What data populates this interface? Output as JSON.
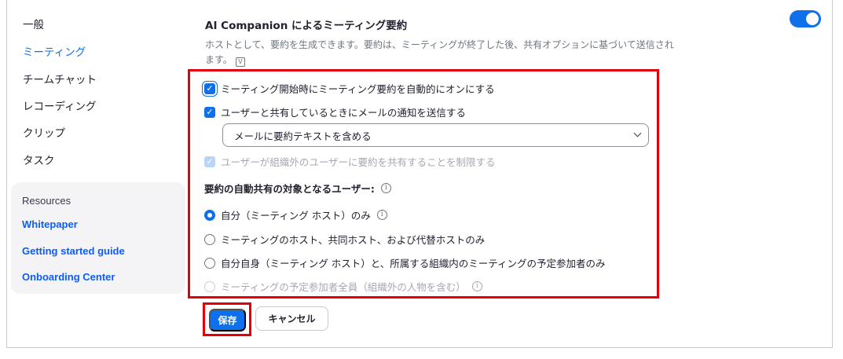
{
  "sidebar": {
    "items": [
      {
        "label": "一般"
      },
      {
        "label": "ミーティング"
      },
      {
        "label": "チームチャット"
      },
      {
        "label": "レコーディング"
      },
      {
        "label": "クリップ"
      },
      {
        "label": "タスク"
      }
    ],
    "active_index": 1,
    "resources": {
      "title": "Resources",
      "links": [
        "Whitepaper",
        "Getting started guide",
        "Onboarding Center"
      ]
    }
  },
  "setting": {
    "title": "AI Companion によるミーティング要約",
    "description": "ホストとして、要約を生成できます。要約は、ミーティングが終了した後、共有オプションに基づいて送信され",
    "description_line2": "ます。",
    "description_icon": "v-badge-icon",
    "enabled": true,
    "options": {
      "auto_on": {
        "label": "ミーティング開始時にミーティング要約を自動的にオンにする",
        "checked": true
      },
      "email_notify": {
        "label": "ユーザーと共有しているときにメールの通知を送信する",
        "checked": true
      },
      "email_select": {
        "value": "メールに要約テキストを含める"
      },
      "restrict_external": {
        "label": "ユーザーが組織外のユーザーに要約を共有することを制限する",
        "checked": true,
        "disabled": true
      }
    },
    "share_targets": {
      "heading": "要約の自動共有の対象となるユーザー:",
      "choices": [
        {
          "label": "自分（ミーティング ホスト）のみ",
          "selected": true,
          "info": true
        },
        {
          "label": "ミーティングのホスト、共同ホスト、および代替ホストのみ",
          "selected": false
        },
        {
          "label": "自分自身（ミーティング ホスト）と、所属する組織内のミーティングの予定参加者のみ",
          "selected": false
        },
        {
          "label": "ミーティングの予定参加者全員（組織外の人物を含む）",
          "selected": false,
          "disabled": true,
          "info": true
        }
      ]
    }
  },
  "actions": {
    "save": "保存",
    "cancel": "キャンセル"
  },
  "colors": {
    "accent": "#0e71eb",
    "highlight": "#e3000b",
    "link": "#0b5cff"
  }
}
